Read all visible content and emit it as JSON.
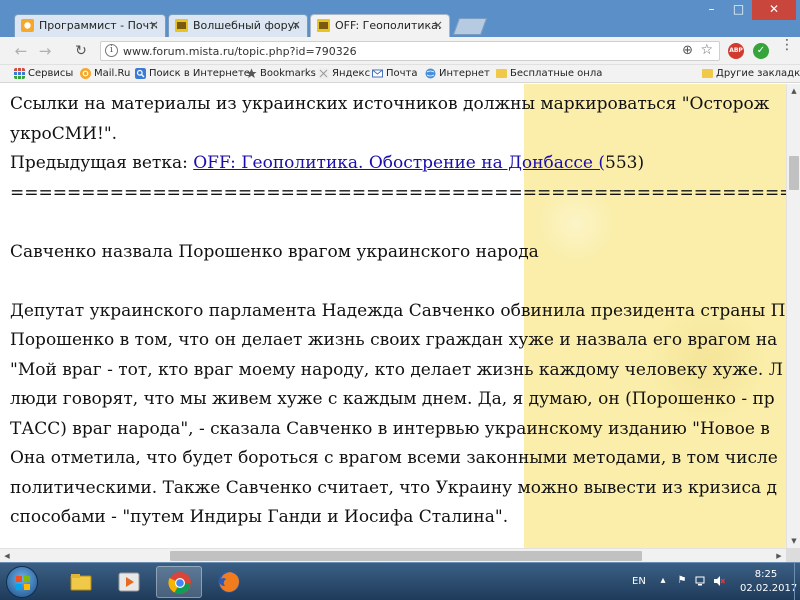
{
  "browser": {
    "tabs": [
      {
        "label": "Программист - Почта М",
        "active": false
      },
      {
        "label": "Волшебный форум",
        "active": false
      },
      {
        "label": "OFF: Геополитика. Пути",
        "active": true
      }
    ],
    "close_glyph": "×",
    "window": {
      "minimize": "–",
      "maximize": "□",
      "close": "✕"
    },
    "nav": {
      "back": "←",
      "forward": "→",
      "reload": "↻"
    },
    "info_glyph": "i",
    "url": "www.forum.mista.ru/topic.php?id=790326",
    "zoom_glyph": "⊕",
    "star_glyph": "☆",
    "ext_abp": "ABP",
    "ext_check": "✓",
    "menu_glyph": "⋮",
    "bookmarks": [
      {
        "label": "Сервисы",
        "icon": "apps-icon"
      },
      {
        "label": "Mail.Ru",
        "icon": "mailru-icon"
      },
      {
        "label": "Поиск в Интернете",
        "icon": "search-icon"
      },
      {
        "label": "Bookmarks",
        "icon": "bookmark-icon"
      },
      {
        "label": "Яндекс",
        "icon": "yandex-icon"
      },
      {
        "label": "Почта",
        "icon": "mail-icon"
      },
      {
        "label": "Интернет",
        "icon": "globe-icon"
      },
      {
        "label": "Бесплатные онлайн с",
        "icon": "folder-icon"
      },
      {
        "label": "Другие закладки",
        "icon": "folder-icon"
      }
    ]
  },
  "page": {
    "line1": "Ссылки на материалы из украинских источников должны маркироваться \"Осторож",
    "line2": "укроСМИ!\".",
    "prev_label": "Предыдущая ветка: ",
    "prev_link": "OFF: Геополитика. Обострение на Донбассе (",
    "prev_count": "553",
    "prev_close": ")",
    "separator": "==================================================================",
    "headline": "Савченко назвала Порошенко врагом украинского народа",
    "paragraph": [
      "Депутат украинского парламента Надежда Савченко обвинила президента страны П",
      "Порошенко в том, что он делает жизнь своих граждан хуже и назвала его врагом на",
      "\"Мой враг - тот, кто враг моему народу, кто делает жизнь каждому человеку хуже. Л",
      "люди говорят, что мы живем хуже с каждым днем. Да, я думаю, он (Порошенко - пр",
      "ТАСС) враг народа\", - сказала Савченко в интервью украинскому изданию \"Новое в",
      "Она отметила, что будет бороться с врагом всеми законными методами, в том числе",
      "политическими. Также Савченко считает, что Украину можно вывести из кризиса д",
      "способами - \"путем Индиры Ганди и Иосифа Сталина\"."
    ]
  },
  "scroll": {
    "up": "▲",
    "down": "▼",
    "left": "◀",
    "right": "▶"
  },
  "taskbar": {
    "items": [
      "explorer-icon",
      "media-player-icon",
      "chrome-icon",
      "firefox-icon"
    ],
    "lang": "EN",
    "time": "8:25",
    "date": "02.02.2017",
    "tray_flag": "⚑",
    "tray_arrow": "▴"
  },
  "colors": {
    "page_yellow": "#faeeaa",
    "link": "#1a0dab",
    "tab_bar": "#5a8fc8"
  }
}
